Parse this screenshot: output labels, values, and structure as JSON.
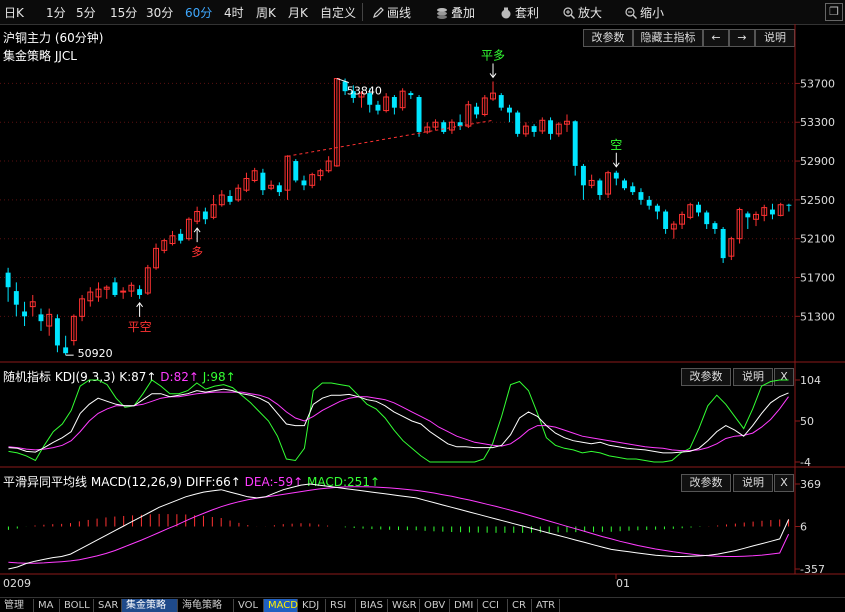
{
  "toolbar": {
    "periods": [
      "日K",
      "1分",
      "5分",
      "15分",
      "30分",
      "60分",
      "4时",
      "周K",
      "月K",
      "自定义"
    ],
    "active_period": "60分",
    "tools": [
      "画线",
      "叠加",
      "套利",
      "放大",
      "缩小"
    ]
  },
  "main_panel": {
    "title": "沪铜主力 (60分钟)",
    "strategy": "集金策略 JJCL",
    "buttons": [
      "改参数",
      "隐藏主指标",
      "←",
      "→",
      "说明"
    ]
  },
  "kdj_panel": {
    "title": "随机指标",
    "params": "KDJ(9,3,3)",
    "k_label": "K:87↑",
    "d_label": "D:82↑",
    "j_label": "J:98↑",
    "buttons": [
      "改参数",
      "说明",
      "X"
    ],
    "axis_ticks": [
      "104",
      "50",
      "-4"
    ]
  },
  "macd_panel": {
    "title": "平滑异同平均线",
    "params": "MACD(12,26,9)",
    "diff_label": "DIFF:66↑",
    "dea_label": "DEA:-59↑",
    "macd_label": "MACD:251↑",
    "buttons": [
      "改参数",
      "说明",
      "X"
    ],
    "axis_ticks": [
      "369",
      "6",
      "-357"
    ]
  },
  "x_axis": {
    "labels": [
      "0209",
      "01"
    ]
  },
  "bottom_tabs": [
    "管理",
    "MA",
    "BOLL",
    "SAR",
    "集金策略",
    "海龟策略",
    "VOL",
    "MACD",
    "KDJ",
    "RSI",
    "BIAS",
    "W&R",
    "OBV",
    "DMI",
    "CCI",
    "CR",
    "ATR"
  ],
  "active_tab": "集金策略",
  "colors": {
    "up": "#ff3232",
    "down": "#00e5ff",
    "k_line": "#ffffff",
    "d_line": "#ff3cff",
    "j_line": "#33ff33",
    "signal_red": "#ff3232",
    "signal_green": "#33ff33",
    "trend": "#ff3232"
  },
  "chart_data": {
    "type": "candlestick",
    "title": "沪铜主力 (60分钟)",
    "y_ticks": [
      53700,
      53300,
      52900,
      52500,
      52100,
      51700,
      51300
    ],
    "ylim": [
      50850,
      53900
    ],
    "annotations": {
      "high_label": "53840",
      "low_label": "50920",
      "signals": [
        {
          "text": "平空",
          "index": 16
        },
        {
          "text": "多",
          "index": 23
        },
        {
          "text": "平多",
          "index": 59
        },
        {
          "text": "空",
          "index": 74
        }
      ]
    },
    "candles": [
      [
        51750,
        51600,
        51450,
        51800
      ],
      [
        51560,
        51420,
        51300,
        51650
      ],
      [
        51350,
        51300,
        51200,
        51450
      ],
      [
        51400,
        51450,
        51300,
        51520
      ],
      [
        51320,
        51250,
        51150,
        51380
      ],
      [
        51200,
        51320,
        51100,
        51380
      ],
      [
        51280,
        51000,
        50930,
        51320
      ],
      [
        50980,
        50920,
        50900,
        51100
      ],
      [
        51050,
        51300,
        51000,
        51320
      ],
      [
        51300,
        51480,
        51250,
        51520
      ],
      [
        51460,
        51550,
        51400,
        51600
      ],
      [
        51500,
        51580,
        51450,
        51650
      ],
      [
        51580,
        51600,
        51480,
        51620
      ],
      [
        51650,
        51520,
        51500,
        51700
      ],
      [
        51550,
        51560,
        51480,
        51600
      ],
      [
        51560,
        51620,
        51500,
        51650
      ],
      [
        51580,
        51520,
        51480,
        51620
      ],
      [
        51540,
        51800,
        51520,
        51830
      ],
      [
        51800,
        52000,
        51780,
        52050
      ],
      [
        51980,
        52080,
        51950,
        52100
      ],
      [
        52050,
        52130,
        52030,
        52180
      ],
      [
        52150,
        52080,
        52050,
        52200
      ],
      [
        52100,
        52300,
        52080,
        52320
      ],
      [
        52280,
        52380,
        52250,
        52430
      ],
      [
        52380,
        52300,
        52250,
        52420
      ],
      [
        52320,
        52450,
        52300,
        52550
      ],
      [
        52450,
        52550,
        52430,
        52600
      ],
      [
        52540,
        52480,
        52450,
        52600
      ],
      [
        52500,
        52620,
        52480,
        52660
      ],
      [
        52600,
        52720,
        52580,
        52780
      ],
      [
        52700,
        52800,
        52680,
        52830
      ],
      [
        52780,
        52600,
        52550,
        52820
      ],
      [
        52620,
        52650,
        52600,
        52700
      ],
      [
        52650,
        52580,
        52540,
        52680
      ],
      [
        52600,
        52950,
        52500,
        52960
      ],
      [
        52900,
        52700,
        52680,
        52920
      ],
      [
        52700,
        52650,
        52600,
        52750
      ],
      [
        52650,
        52760,
        52620,
        52780
      ],
      [
        52750,
        52800,
        52700,
        52820
      ],
      [
        52800,
        52900,
        52780,
        52950
      ],
      [
        52850,
        53750,
        52840,
        53750
      ],
      [
        53720,
        53620,
        53580,
        53750
      ],
      [
        53620,
        53550,
        53500,
        53680
      ],
      [
        53560,
        53600,
        53450,
        53620
      ],
      [
        53600,
        53480,
        53400,
        53650
      ],
      [
        53480,
        53420,
        53380,
        53520
      ],
      [
        53420,
        53560,
        53400,
        53600
      ],
      [
        53560,
        53450,
        53380,
        53580
      ],
      [
        53450,
        53620,
        53420,
        53650
      ],
      [
        53600,
        53580,
        53540,
        53620
      ],
      [
        53560,
        53200,
        53150,
        53580
      ],
      [
        53200,
        53250,
        53180,
        53300
      ],
      [
        53250,
        53300,
        53220,
        53330
      ],
      [
        53300,
        53200,
        53180,
        53320
      ],
      [
        53220,
        53300,
        53180,
        53330
      ],
      [
        53300,
        53260,
        53220,
        53380
      ],
      [
        53260,
        53480,
        53240,
        53520
      ],
      [
        53460,
        53380,
        53340,
        53500
      ],
      [
        53380,
        53550,
        53360,
        53580
      ],
      [
        53540,
        53600,
        53520,
        53720
      ],
      [
        53580,
        53450,
        53420,
        53600
      ],
      [
        53450,
        53400,
        53300,
        53480
      ],
      [
        53400,
        53180,
        53150,
        53420
      ],
      [
        53180,
        53260,
        53150,
        53300
      ],
      [
        53260,
        53200,
        53150,
        53280
      ],
      [
        53210,
        53320,
        53180,
        53350
      ],
      [
        53320,
        53180,
        53120,
        53350
      ],
      [
        53180,
        53280,
        53150,
        53300
      ],
      [
        53280,
        53310,
        53200,
        53380
      ],
      [
        53310,
        52850,
        52750,
        53320
      ],
      [
        52850,
        52650,
        52500,
        52870
      ],
      [
        52650,
        52700,
        52620,
        52760
      ],
      [
        52700,
        52550,
        52500,
        52720
      ],
      [
        52560,
        52780,
        52520,
        52800
      ],
      [
        52780,
        52720,
        52650,
        52800
      ],
      [
        52700,
        52620,
        52600,
        52720
      ],
      [
        52640,
        52580,
        52550,
        52680
      ],
      [
        52580,
        52500,
        52450,
        52620
      ],
      [
        52500,
        52440,
        52400,
        52540
      ],
      [
        52440,
        52380,
        52300,
        52460
      ],
      [
        52380,
        52200,
        52150,
        52400
      ],
      [
        52200,
        52250,
        52100,
        52280
      ],
      [
        52250,
        52350,
        52200,
        52380
      ],
      [
        52320,
        52450,
        52300,
        52470
      ],
      [
        52450,
        52370,
        52330,
        52480
      ],
      [
        52370,
        52250,
        52200,
        52390
      ],
      [
        52260,
        52200,
        52150,
        52280
      ],
      [
        52200,
        51900,
        51850,
        52220
      ],
      [
        51920,
        52100,
        51880,
        52120
      ],
      [
        52100,
        52400,
        52050,
        52420
      ],
      [
        52360,
        52320,
        52200,
        52380
      ],
      [
        52300,
        52350,
        52230,
        52380
      ],
      [
        52340,
        52420,
        52280,
        52450
      ],
      [
        52400,
        52350,
        52300,
        52460
      ],
      [
        52340,
        52450,
        52330,
        52470
      ],
      [
        52450,
        52440,
        52380,
        52460
      ]
    ],
    "kdj": {
      "k": [
        15,
        14,
        10,
        9,
        15,
        22,
        28,
        36,
        60,
        72,
        80,
        76,
        72,
        70,
        70,
        78,
        86,
        86,
        82,
        84,
        86,
        90,
        88,
        90,
        92,
        90,
        86,
        84,
        80,
        74,
        60,
        46,
        44,
        44,
        72,
        80,
        84,
        84,
        85,
        82,
        78,
        76,
        70,
        62,
        56,
        50,
        46,
        36,
        28,
        20,
        16,
        16,
        15,
        15,
        15,
        18,
        32,
        54,
        62,
        56,
        44,
        34,
        28,
        24,
        22,
        20,
        22,
        18,
        16,
        14,
        13,
        12,
        10,
        8,
        8,
        9,
        10,
        14,
        24,
        36,
        44,
        38,
        30,
        44,
        60,
        74,
        82,
        87
      ],
      "d": [
        16,
        15,
        13,
        12,
        13,
        15,
        18,
        24,
        36,
        50,
        60,
        66,
        70,
        70,
        70,
        72,
        76,
        80,
        82,
        82,
        84,
        86,
        87,
        88,
        88,
        88,
        88,
        86,
        84,
        80,
        72,
        62,
        54,
        50,
        56,
        64,
        70,
        76,
        80,
        82,
        82,
        80,
        78,
        74,
        68,
        62,
        56,
        50,
        42,
        36,
        30,
        26,
        22,
        20,
        18,
        17,
        20,
        28,
        38,
        44,
        44,
        42,
        38,
        34,
        30,
        28,
        26,
        24,
        22,
        20,
        18,
        16,
        15,
        14,
        12,
        11,
        11,
        12,
        15,
        20,
        27,
        30,
        31,
        34,
        42,
        52,
        66,
        82
      ],
      "j": [
        10,
        8,
        4,
        -2,
        18,
        36,
        46,
        64,
        96,
        104,
        104,
        98,
        80,
        68,
        70,
        86,
        104,
        96,
        86,
        86,
        90,
        100,
        92,
        96,
        98,
        94,
        84,
        74,
        62,
        50,
        30,
        0,
        -2,
        14,
        90,
        100,
        100,
        98,
        96,
        84,
        72,
        66,
        54,
        38,
        24,
        14,
        4,
        -4,
        -4,
        -4,
        -4,
        -4,
        -4,
        0,
        20,
        56,
        98,
        102,
        90,
        60,
        28,
        18,
        14,
        12,
        8,
        10,
        8,
        4,
        2,
        0,
        0,
        -2,
        -4,
        -4,
        -2,
        8,
        14,
        40,
        70,
        84,
        72,
        56,
        40,
        66,
        96,
        102,
        104,
        104
      ]
    },
    "macd": {
      "diff": [
        -357,
        -340,
        -310,
        -290,
        -275,
        -260,
        -250,
        -230,
        -190,
        -150,
        -110,
        -70,
        -30,
        10,
        50,
        90,
        130,
        170,
        200,
        230,
        260,
        280,
        300,
        310,
        320,
        300,
        280,
        260,
        250,
        260,
        290,
        320,
        340,
        360,
        369,
        360,
        350,
        340,
        330,
        320,
        310,
        300,
        290,
        280,
        270,
        260,
        250,
        230,
        210,
        190,
        170,
        150,
        130,
        110,
        90,
        70,
        50,
        30,
        10,
        -10,
        -30,
        -50,
        -70,
        -90,
        -110,
        -130,
        -150,
        -170,
        -190,
        -200,
        -210,
        -220,
        -230,
        -240,
        -245,
        -250,
        -250,
        -248,
        -245,
        -240,
        -230,
        -215,
        -200,
        -180,
        -160,
        -140,
        -120,
        -100,
        66
      ],
      "dea": [
        -300,
        -305,
        -308,
        -308,
        -305,
        -300,
        -295,
        -288,
        -278,
        -262,
        -245,
        -225,
        -200,
        -170,
        -140,
        -110,
        -78,
        -45,
        -12,
        20,
        55,
        88,
        118,
        148,
        175,
        198,
        218,
        235,
        248,
        258,
        268,
        280,
        292,
        304,
        316,
        326,
        334,
        340,
        344,
        346,
        346,
        344,
        340,
        336,
        330,
        322,
        314,
        304,
        292,
        278,
        264,
        248,
        232,
        214,
        196,
        178,
        158,
        138,
        118,
        96,
        74,
        52,
        30,
        8,
        -14,
        -36,
        -58,
        -80,
        -100,
        -120,
        -138,
        -156,
        -172,
        -186,
        -198,
        -210,
        -220,
        -230,
        -238,
        -244,
        -248,
        -250,
        -250,
        -248,
        -244,
        -238,
        -230,
        -220,
        -59
      ]
    },
    "xlabels": [
      "0209",
      "01"
    ]
  }
}
